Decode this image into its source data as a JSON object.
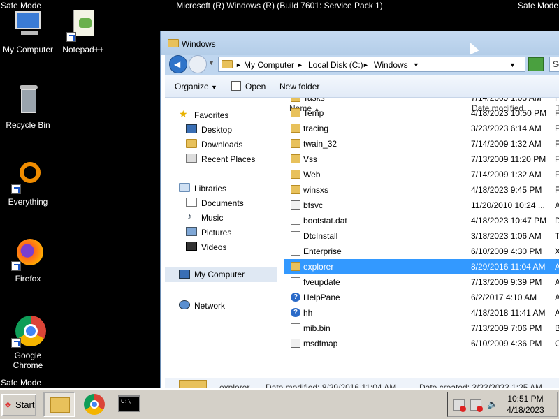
{
  "desktop": {
    "safe_mode_tl": "Safe Mode",
    "safe_mode_tr": "Safe Mode",
    "safe_mode_bl": "Safe Mode",
    "os_title": "Microsoft (R) Windows (R) (Build 7601: Service Pack 1)",
    "icons": [
      {
        "label": "My Computer",
        "icon": "computer-icon"
      },
      {
        "label": "Notepad++",
        "icon": "notepadpp-icon"
      },
      {
        "label": "Recycle Bin",
        "icon": "recycle-bin-icon"
      },
      {
        "label": "Everything",
        "icon": "everything-icon"
      },
      {
        "label": "Firefox",
        "icon": "firefox-icon"
      },
      {
        "label": "Google Chrome",
        "icon": "chrome-icon"
      }
    ]
  },
  "explorer": {
    "title": "Windows",
    "breadcrumb": [
      "My Computer",
      "Local Disk (C:)",
      "Windows"
    ],
    "search_placeholder": "Sea",
    "toolbar": {
      "organize": "Organize",
      "open": "Open",
      "new_folder": "New folder"
    },
    "nav": {
      "favorites": "Favorites",
      "desktop": "Desktop",
      "downloads": "Downloads",
      "recent": "Recent Places",
      "libraries": "Libraries",
      "documents": "Documents",
      "music": "Music",
      "pictures": "Pictures",
      "videos": "Videos",
      "computer": "My Computer",
      "network": "Network"
    },
    "columns": {
      "name": "Name",
      "date": "Date modified",
      "type": "T"
    },
    "rows": [
      {
        "name": "Tasks",
        "date": "7/14/2009 1:08 AM",
        "type": "F",
        "icon": "folder"
      },
      {
        "name": "Temp",
        "date": "4/18/2023 10:50 PM",
        "type": "F",
        "icon": "folder"
      },
      {
        "name": "tracing",
        "date": "3/23/2023 6:14 AM",
        "type": "F",
        "icon": "folder"
      },
      {
        "name": "twain_32",
        "date": "7/14/2009 1:32 AM",
        "type": "F",
        "icon": "folder"
      },
      {
        "name": "Vss",
        "date": "7/13/2009 11:20 PM",
        "type": "F",
        "icon": "folder"
      },
      {
        "name": "Web",
        "date": "7/14/2009 1:32 AM",
        "type": "F",
        "icon": "folder"
      },
      {
        "name": "winsxs",
        "date": "4/18/2023 9:45 PM",
        "type": "F",
        "icon": "folder"
      },
      {
        "name": "bfsvc",
        "date": "11/20/2010 10:24 ...",
        "type": "A",
        "icon": "app"
      },
      {
        "name": "bootstat.dat",
        "date": "4/18/2023 10:47 PM",
        "type": "D",
        "icon": "file"
      },
      {
        "name": "DtcInstall",
        "date": "3/18/2023 1:06 AM",
        "type": "T",
        "icon": "file"
      },
      {
        "name": "Enterprise",
        "date": "6/10/2009 4:30 PM",
        "type": "X",
        "icon": "file"
      },
      {
        "name": "explorer",
        "date": "8/29/2016 11:04 AM",
        "type": "A",
        "icon": "folder",
        "selected": true
      },
      {
        "name": "fveupdate",
        "date": "7/13/2009 9:39 PM",
        "type": "A",
        "icon": "file"
      },
      {
        "name": "HelpPane",
        "date": "6/2/2017 4:10 AM",
        "type": "A",
        "icon": "help"
      },
      {
        "name": "hh",
        "date": "4/18/2018 11:41 AM",
        "type": "A",
        "icon": "help"
      },
      {
        "name": "mib.bin",
        "date": "7/13/2009 7:06 PM",
        "type": "B",
        "icon": "file"
      },
      {
        "name": "msdfmap",
        "date": "6/10/2009 4:36 PM",
        "type": "C",
        "icon": "app"
      }
    ],
    "details": {
      "name": "explorer",
      "modified": "Date modified: 8/29/2016 11:04 AM",
      "created": "Date created: 3/23/2023 1:25 AM"
    }
  },
  "taskbar": {
    "start": "Start",
    "time": "10:51 PM",
    "date": "4/18/2023",
    "tray_icons": [
      "network-error-icon",
      "action-center-error-icon",
      "volume-muted-icon"
    ]
  }
}
